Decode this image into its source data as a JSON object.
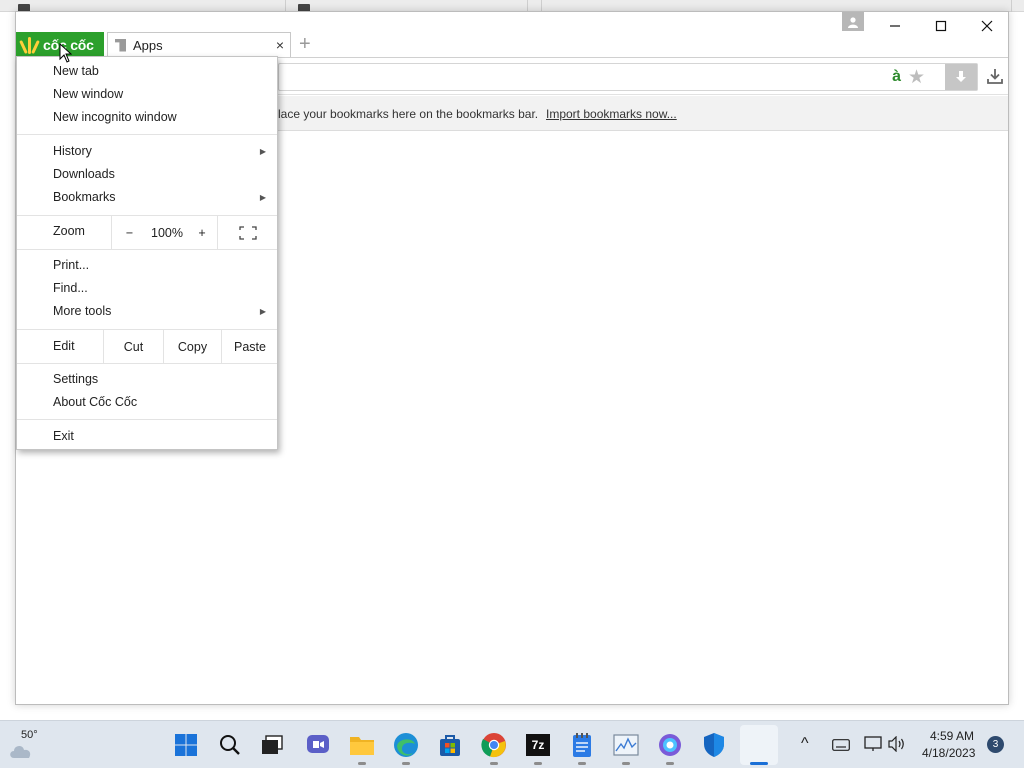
{
  "browser": {
    "logo_text": "cốc cốc",
    "tab_title": "Apps",
    "tab_close": "×",
    "new_tab_symbol": "+",
    "window_controls": {
      "minimize": "—",
      "maximize": "☐",
      "close": "✕"
    },
    "omnibox_badge": "à",
    "bookmark_bar": {
      "text": "lace your bookmarks here on the bookmarks bar.",
      "link": "Import bookmarks now..."
    }
  },
  "menu": {
    "new_tab": "New tab",
    "new_window": "New window",
    "new_incognito": "New incognito window",
    "history": "History",
    "downloads": "Downloads",
    "bookmarks": "Bookmarks",
    "submenu_arrow": "▶",
    "zoom": {
      "label": "Zoom",
      "minus": "−",
      "value": "100%",
      "plus": "+"
    },
    "print": "Print...",
    "find": "Find...",
    "more_tools": "More tools",
    "edit": {
      "label": "Edit",
      "cut": "Cut",
      "copy": "Copy",
      "paste": "Paste"
    },
    "settings": "Settings",
    "about": "About Cốc Cốc",
    "exit": "Exit"
  },
  "taskbar": {
    "weather_temp": "50°",
    "clock_time": "4:59 AM",
    "clock_date": "4/18/2023",
    "notification_count": "3",
    "tray_chevron": "^",
    "seven_zip_label": "7z"
  },
  "icons": {
    "profile": "person-icon",
    "star": "bookmark-star-icon",
    "download": "download-icon",
    "fullscreen": "fullscreen-icon",
    "start": "windows-start-icon",
    "search": "search-icon",
    "task_view": "task-view-icon",
    "chat": "chat-icon",
    "explorer": "file-explorer-icon",
    "edge": "edge-browser-icon",
    "store": "store-icon",
    "chrome": "chrome-browser-icon",
    "seven_zip": "7zip-icon",
    "notepad": "notepad-icon",
    "monitor": "resource-monitor-icon",
    "photos": "photos-icon",
    "defender": "defender-shield-icon",
    "coccoc": "coccoc-taskbar-icon"
  },
  "colors": {
    "brand_green": "#2ca02c",
    "accent_blue": "#1a6fd6",
    "taskbar_bg": "#dfe6ee"
  }
}
